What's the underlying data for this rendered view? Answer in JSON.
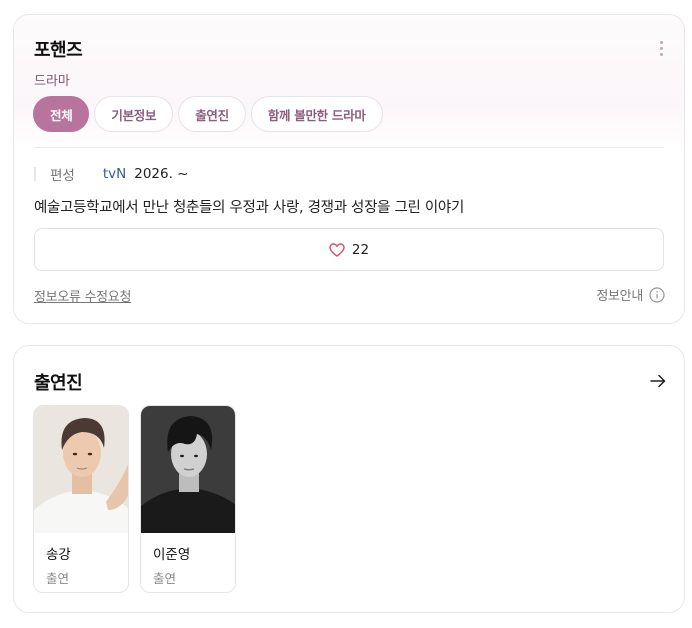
{
  "program": {
    "title": "포핸즈",
    "genre": "드라마",
    "tabs": [
      {
        "label": "전체",
        "active": true
      },
      {
        "label": "기본정보",
        "active": false
      },
      {
        "label": "출연진",
        "active": false
      },
      {
        "label": "함께 볼만한 드라마",
        "active": false
      }
    ],
    "broadcast": {
      "label": "편성",
      "channel": "tvN",
      "date": "2026. ~"
    },
    "synopsis": "예술고등학교에서 만난 청춘들의 우정과 사랑, 경쟁과 성장을 그린 이야기",
    "likes": "22",
    "report_link": "정보오류 수정요청",
    "info_guide": "정보안내"
  },
  "cast_section": {
    "title": "출연진",
    "members": [
      {
        "name": "송강",
        "role": "출연"
      },
      {
        "name": "이준영",
        "role": "출연"
      }
    ]
  },
  "colors": {
    "accent": "#b9749d",
    "tab_text": "#8c5e7e",
    "channel_link": "#2e5aa7",
    "heart": "#e0546d"
  },
  "icons": [
    "more-vertical-icon",
    "heart-icon",
    "info-circle-icon",
    "arrow-right-icon"
  ]
}
